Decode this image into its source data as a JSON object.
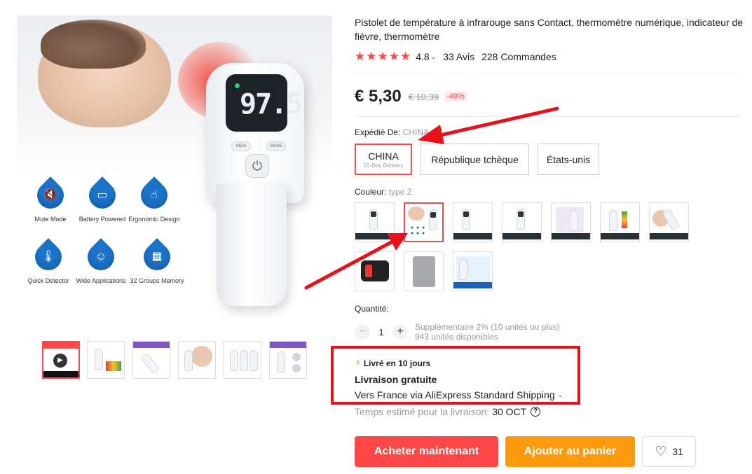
{
  "product": {
    "title": "Pistolet de température à infrarouge sans Contact, thermomètre numérique, indicateur de fièvre, thermomètre",
    "stars": "★★★★★",
    "rating": "4.8",
    "reviews": "33 Avis",
    "orders": "228 Commandes"
  },
  "image": {
    "reading": "97.5",
    "mem_label": "MEM",
    "mode_label": "MODE",
    "features": [
      {
        "label": "Mute Mode",
        "icon": "speaker-mute-icon"
      },
      {
        "label": "Battery Powered",
        "icon": "battery-icon"
      },
      {
        "label": "Ergonomic Design",
        "icon": "hand-icon"
      },
      {
        "label": "Quick Detector",
        "icon": "thermometer-icon"
      },
      {
        "label": "Wide Applications",
        "icon": "person-icon"
      },
      {
        "label": "32 Groups Memory",
        "icon": "calendar-icon"
      }
    ]
  },
  "gallery_badge": "10-Day Delivery",
  "price": {
    "current": "€ 5,30",
    "original": "€ 10,39",
    "discount": "-49%"
  },
  "shipping_from": {
    "label": "Expédié De:",
    "value": "CHINA",
    "options": [
      {
        "label": "CHINA",
        "sub": "10-Day Delivery",
        "selected": true
      },
      {
        "label": "République tchèque",
        "selected": false
      },
      {
        "label": "États-unis",
        "selected": false
      }
    ]
  },
  "color": {
    "label": "Couleur:",
    "value": "type 2"
  },
  "quantity": {
    "label": "Quantité:",
    "minus": "−",
    "value": "1",
    "plus": "+",
    "bulk_note": "Supplémentaire 2% (10 unités ou plus)",
    "available": "943 unités disponibles"
  },
  "delivery": {
    "badge": "Livré en 10 jours",
    "free_shipping": "Livraison gratuite",
    "via": "Vers France via AliExpress Standard Shipping",
    "eta_label": "Temps estimé pour la livraison:",
    "eta_date": "30 OCT",
    "help": "?"
  },
  "actions": {
    "buy_now": "Acheter maintenant",
    "add_to_cart": "Ajouter au panier",
    "wishlist_count": "31"
  },
  "colors": {
    "accent": "#ff4747",
    "cart": "#ff9a0e",
    "annotation": "#e8101a",
    "feature_blue": "#1b73c9"
  }
}
